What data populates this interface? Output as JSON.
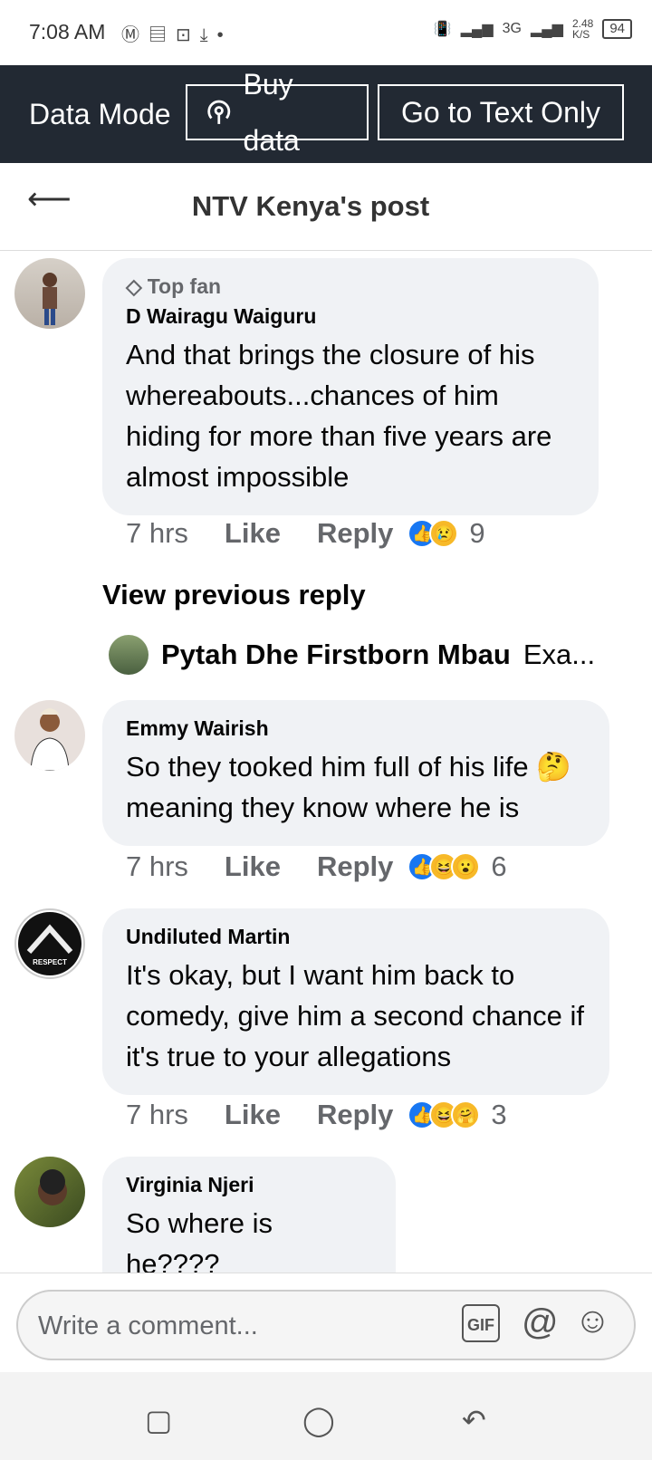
{
  "status_bar": {
    "time": "7:08 AM",
    "left_icons": [
      "messenger-icon",
      "news-icon",
      "screenshot-icon",
      "download-icon",
      "dot-icon"
    ],
    "net_speed": "2.48\nK/S",
    "network": "3G",
    "battery": "94"
  },
  "data_mode": {
    "label": "Data Mode",
    "buy_data": "Buy data",
    "text_only": "Go to Text Only"
  },
  "header": {
    "title": "NTV Kenya's post"
  },
  "comments": [
    {
      "badge": "Top fan",
      "author": "D Wairagu Waiguru",
      "text": "And that brings the closure of his whereabouts...chances of him hiding for more than five years are almost impossible",
      "time": "7 hrs",
      "like": "Like",
      "reply": "Reply",
      "reactions": [
        "like",
        "sad"
      ],
      "count": "9"
    },
    {
      "author": "Emmy Wairish",
      "text": "So they tooked him full of his life 🤔 meaning they know where he is",
      "time": "7 hrs",
      "like": "Like",
      "reply": "Reply",
      "reactions": [
        "like",
        "haha",
        "wow"
      ],
      "count": "6"
    },
    {
      "author": "Undiluted Martin",
      "avatar_text": "RESPECT",
      "text": "It's okay, but I want him back to comedy, give him a second chance if it's true to your allegations",
      "time": "7 hrs",
      "like": "Like",
      "reply": "Reply",
      "reactions": [
        "like",
        "haha",
        "care"
      ],
      "count": "3"
    },
    {
      "author": "Virginia Njeri",
      "text": "So where is he????"
    }
  ],
  "view_previous": "View previous reply",
  "reply_preview": {
    "author": "Pytah Dhe Firstborn Mbau",
    "snippet": "Exa..."
  },
  "composer": {
    "placeholder": "Write a comment...",
    "gif_label": "GIF"
  },
  "colors": {
    "data_bar": "#222933",
    "bubble": "#f0f2f5",
    "like_blue": "#1877f2",
    "secondary_text": "#65676b"
  }
}
